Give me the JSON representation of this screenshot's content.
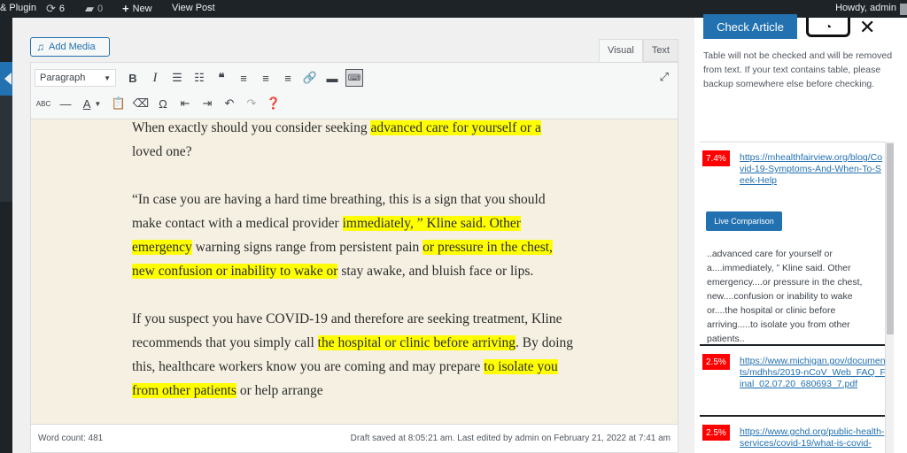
{
  "adminbar": {
    "site_label": "& Plugin",
    "updates_count": "6",
    "comments_count": "0",
    "new_label": "New",
    "view_post_label": "View Post",
    "howdy_label": "Howdy, admin",
    "icons": {
      "updates": "refresh-icon",
      "comments": "comment-icon",
      "new": "plus-icon"
    }
  },
  "editor": {
    "add_media_label": "Add Media",
    "tabs": [
      "Visual",
      "Text"
    ],
    "active_tab": "Visual",
    "format_select": "Paragraph",
    "paragraphs": [
      [
        {
          "t": "When exactly should you consider seeking ",
          "h": false
        },
        {
          "t": "advanced care for yourself or a",
          "h": true
        },
        {
          "t": " loved one?",
          "h": false
        }
      ],
      [
        {
          "t": "“In case you are having a hard time breathing, this is a sign that you should make contact with a medical provider ",
          "h": false
        },
        {
          "t": "immediately, ” Kline said. Other emergency",
          "h": true
        },
        {
          "t": " warning signs range from persistent pain ",
          "h": false
        },
        {
          "t": "or pressure in the chest, new confusion or inability to wake or",
          "h": true
        },
        {
          "t": " stay awake, and bluish face or lips.",
          "h": false
        }
      ],
      [
        {
          "t": "If you suspect you have COVID-19 and therefore are seeking treatment, Kline recommends that you simply call ",
          "h": false
        },
        {
          "t": "the hospital or clinic before arriving",
          "h": true
        },
        {
          "t": ". By doing this, healthcare workers know you are coming and may prepare ",
          "h": false
        },
        {
          "t": "to isolate you from other patients",
          "h": true
        },
        {
          "t": " or help arrange",
          "h": false
        }
      ]
    ],
    "word_count": "Word count: 481",
    "draft_status": "Draft saved at 8:05:21 am. Last edited by admin on February 21, 2022 at 7:41 am",
    "highlight_color": "#ffff00",
    "content_bg": "#f5f0e1"
  },
  "sidebar": {
    "check_button": "Check Article",
    "notice": "Table will not be checked and will be removed from text. If your text contains table, please backup somewhere else before checking.",
    "results": [
      {
        "percent": "7.4%",
        "url": "https://mhealthfairview.org/blog/Covid-19-Symptoms-And-When-To-Seek-Help",
        "live_label": "Live Comparison",
        "excerpt": "..advanced care for yourself or a....immediately, ” Kline said. Other emergency....or pressure in the chest, new....confusion or inability to wake or....the hospital or clinic before arriving.....to isolate you from other patients.."
      },
      {
        "percent": "2.5%",
        "url": "https://www.michigan.gov/documents/mdhhs/2019-nCoV_Web_FAQ_Final_02.07.20_680693_7.pdf"
      },
      {
        "percent": "2.5%",
        "url": "https://www.gchd.org/public-health-services/covid-19/what-is-covid-"
      }
    ],
    "accent_color": "#2271b1",
    "percent_color": "#ff0000"
  }
}
